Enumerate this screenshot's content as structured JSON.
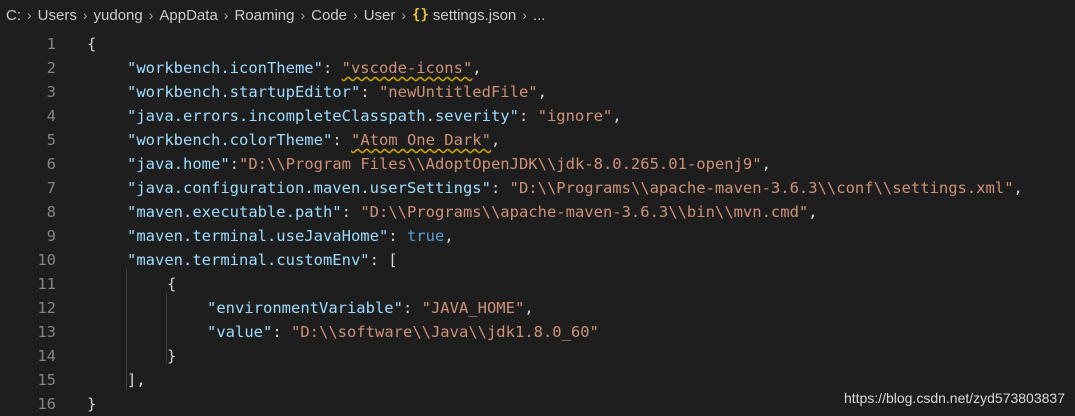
{
  "breadcrumb": {
    "items": [
      "C:",
      "Users",
      "yudong",
      "AppData",
      "Roaming",
      "Code",
      "User"
    ],
    "file_icon": "{}",
    "file": "settings.json",
    "ellipsis": "..."
  },
  "editor": {
    "lines": [
      {
        "n": "1",
        "tokens": [
          [
            "p",
            "{"
          ]
        ]
      },
      {
        "n": "2",
        "tokens": [
          [
            "k",
            "\"workbench.iconTheme\""
          ],
          [
            "p",
            ": "
          ],
          [
            "s squiggle",
            "\"vscode-icons\""
          ],
          [
            "p",
            ","
          ]
        ]
      },
      {
        "n": "3",
        "tokens": [
          [
            "k",
            "\"workbench.startupEditor\""
          ],
          [
            "p",
            ": "
          ],
          [
            "s",
            "\"newUntitledFile\""
          ],
          [
            "p",
            ","
          ]
        ]
      },
      {
        "n": "4",
        "tokens": [
          [
            "k",
            "\"java.errors.incompleteClasspath.severity\""
          ],
          [
            "p",
            ": "
          ],
          [
            "s",
            "\"ignore\""
          ],
          [
            "p",
            ","
          ]
        ]
      },
      {
        "n": "5",
        "tokens": [
          [
            "k",
            "\"workbench.colorTheme\""
          ],
          [
            "p",
            ": "
          ],
          [
            "s squiggle",
            "\"Atom One Dark\""
          ],
          [
            "p",
            ","
          ]
        ]
      },
      {
        "n": "6",
        "tokens": [
          [
            "k",
            "\"java.home\""
          ],
          [
            "p",
            ":"
          ],
          [
            "s",
            "\"D:\\\\Program Files\\\\AdoptOpenJDK\\\\jdk-8.0.265.01-openj9\""
          ],
          [
            "p",
            ","
          ]
        ]
      },
      {
        "n": "7",
        "tokens": [
          [
            "k",
            "\"java.configuration.maven.userSettings\""
          ],
          [
            "p",
            ": "
          ],
          [
            "s",
            "\"D:\\\\Programs\\\\apache-maven-3.6.3\\\\conf\\\\settings.xml\""
          ],
          [
            "p",
            ","
          ]
        ]
      },
      {
        "n": "8",
        "tokens": [
          [
            "k",
            "\"maven.executable.path\""
          ],
          [
            "p",
            ": "
          ],
          [
            "s",
            "\"D:\\\\Programs\\\\apache-maven-3.6.3\\\\bin\\\\mvn.cmd\""
          ],
          [
            "p",
            ","
          ]
        ]
      },
      {
        "n": "9",
        "tokens": [
          [
            "k",
            "\"maven.terminal.useJavaHome\""
          ],
          [
            "p",
            ": "
          ],
          [
            "b",
            "true"
          ],
          [
            "p",
            ","
          ]
        ]
      },
      {
        "n": "10",
        "tokens": [
          [
            "k",
            "\"maven.terminal.customEnv\""
          ],
          [
            "p",
            ": ["
          ]
        ]
      },
      {
        "n": "11",
        "tokens": [
          [
            "p",
            "{"
          ]
        ]
      },
      {
        "n": "12",
        "tokens": [
          [
            "k",
            "\"environmentVariable\""
          ],
          [
            "p",
            ": "
          ],
          [
            "s",
            "\"JAVA_HOME\""
          ],
          [
            "p",
            ","
          ]
        ]
      },
      {
        "n": "13",
        "tokens": [
          [
            "k",
            "\"value\""
          ],
          [
            "p",
            ": "
          ],
          [
            "s",
            "\"D:\\\\software\\\\Java\\\\jdk1.8.0_60\""
          ]
        ]
      },
      {
        "n": "14",
        "tokens": [
          [
            "p",
            "}"
          ]
        ]
      },
      {
        "n": "15",
        "tokens": [
          [
            "p",
            "],"
          ]
        ]
      },
      {
        "n": "16",
        "tokens": [
          [
            "p",
            "}"
          ]
        ]
      }
    ]
  },
  "watermark": "https://blog.csdn.net/zyd573803837",
  "colors": {
    "background": "#1e1e1e",
    "key": "#9cdcfe",
    "string": "#ce9178",
    "boolean": "#569cd6",
    "punctuation": "#d4d4d4",
    "line_number": "#858585",
    "warning_squiggle": "#cca700",
    "json_icon": "#e8c341"
  }
}
